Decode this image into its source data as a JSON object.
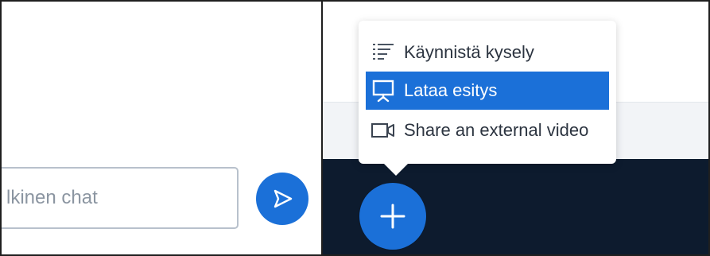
{
  "chat": {
    "input_placeholder": "lkinen chat",
    "send_icon": "send-icon"
  },
  "actions_menu": {
    "items": [
      {
        "label": "Käynnistä kysely",
        "icon": "poll-list-icon",
        "highlighted": false
      },
      {
        "label": "Lataa esitys",
        "icon": "presentation-icon",
        "highlighted": true
      },
      {
        "label": "Share an external video",
        "icon": "video-camera-icon",
        "highlighted": false
      }
    ]
  },
  "actions_button": {
    "icon": "plus-icon"
  },
  "colors": {
    "accent": "#1b70d8",
    "dark_background": "#0d1b2e",
    "menu_text": "#2c3440",
    "input_border": "#b8c1cc"
  }
}
